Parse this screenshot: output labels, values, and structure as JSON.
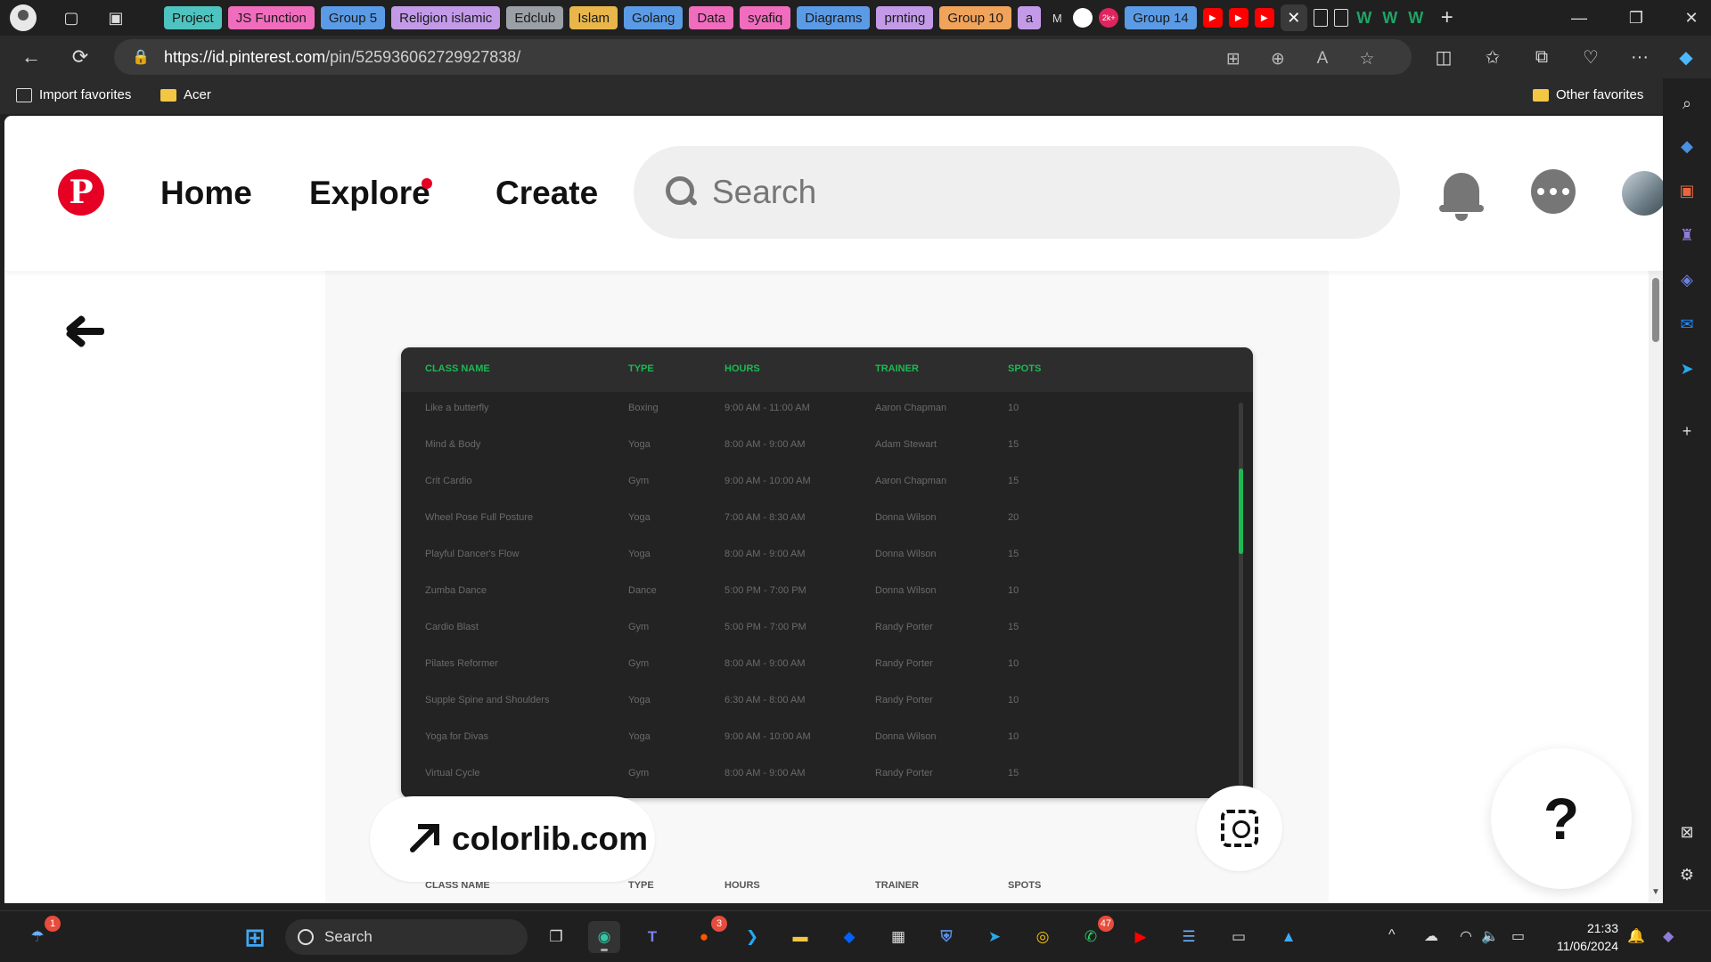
{
  "browser": {
    "tab_groups": [
      {
        "label": "Project",
        "color": "#4fc3bf"
      },
      {
        "label": "JS Function",
        "color": "#f06dbd"
      },
      {
        "label": "Group 5",
        "color": "#5b9be6"
      },
      {
        "label": "Religion islamic",
        "color": "#c39ae8"
      },
      {
        "label": "Edclub",
        "color": "#9aa0a6"
      },
      {
        "label": "Islam",
        "color": "#e8b64b"
      },
      {
        "label": "Golang",
        "color": "#5b9be6"
      },
      {
        "label": "Data",
        "color": "#f06dbd"
      },
      {
        "label": "syafiq",
        "color": "#f06dbd"
      },
      {
        "label": "Diagrams",
        "color": "#5b9be6"
      },
      {
        "label": "prnting",
        "color": "#c39ae8"
      },
      {
        "label": "Group 10",
        "color": "#f0a35b"
      },
      {
        "label": "a",
        "color": "#c39ae8"
      }
    ],
    "group_14": {
      "label": "Group 14",
      "color": "#5b9be6"
    },
    "mini_tab_m": "M",
    "mini_tab_w": "W",
    "mini_tab_gh_badge": "2k+",
    "url_host": "https://id.pinterest.com",
    "url_path": "/pin/525936062729927838/",
    "favorites": {
      "import": "Import favorites",
      "acer": "Acer",
      "other": "Other favorites"
    }
  },
  "pinterest": {
    "nav": {
      "home": "Home",
      "explore": "Explore",
      "create": "Create"
    },
    "logo_glyph": "P",
    "search_placeholder": "Search",
    "source_label": "colorlib.com",
    "help_label": "?",
    "accent": "#e60023"
  },
  "pin_table": {
    "accent": "#1db954",
    "headers": [
      "CLASS NAME",
      "TYPE",
      "HOURS",
      "TRAINER",
      "SPOTS"
    ],
    "rows": [
      [
        "Like a butterfly",
        "Boxing",
        "9:00 AM - 11:00 AM",
        "Aaron Chapman",
        "10"
      ],
      [
        "Mind & Body",
        "Yoga",
        "8:00 AM - 9:00 AM",
        "Adam Stewart",
        "15"
      ],
      [
        "Crit Cardio",
        "Gym",
        "9:00 AM - 10:00 AM",
        "Aaron Chapman",
        "15"
      ],
      [
        "Wheel Pose Full Posture",
        "Yoga",
        "7:00 AM - 8:30 AM",
        "Donna Wilson",
        "20"
      ],
      [
        "Playful Dancer's Flow",
        "Yoga",
        "8:00 AM - 9:00 AM",
        "Donna Wilson",
        "15"
      ],
      [
        "Zumba Dance",
        "Dance",
        "5:00 PM - 7:00 PM",
        "Donna Wilson",
        "10"
      ],
      [
        "Cardio Blast",
        "Gym",
        "5:00 PM - 7:00 PM",
        "Randy Porter",
        "15"
      ],
      [
        "Pilates Reformer",
        "Gym",
        "8:00 AM - 9:00 AM",
        "Randy Porter",
        "10"
      ],
      [
        "Supple Spine and Shoulders",
        "Yoga",
        "6:30 AM - 8:00 AM",
        "Randy Porter",
        "10"
      ],
      [
        "Yoga for Divas",
        "Yoga",
        "9:00 AM - 10:00 AM",
        "Donna Wilson",
        "10"
      ],
      [
        "Virtual Cycle",
        "Gym",
        "8:00 AM - 9:00 AM",
        "Randy Porter",
        "15"
      ]
    ]
  },
  "taskbar": {
    "search_label": "Search",
    "weather_badge": "1",
    "reddit_badge": "3",
    "whatsapp_badge": "47",
    "time": "21:33",
    "date": "11/06/2024"
  },
  "icons": {
    "back": "←",
    "refresh": "⟳",
    "lock": "🔒",
    "star": "☆",
    "plus": "+",
    "minimize": "—",
    "restore": "❐",
    "close": "✕",
    "more": "···",
    "chevron_up": "^",
    "wifi": "◠",
    "volume": "🔈",
    "battery": "▭",
    "bell": "🔔",
    "cloud": "☁",
    "gear": "⚙",
    "search": "⌕",
    "mini_yt": "▶"
  }
}
